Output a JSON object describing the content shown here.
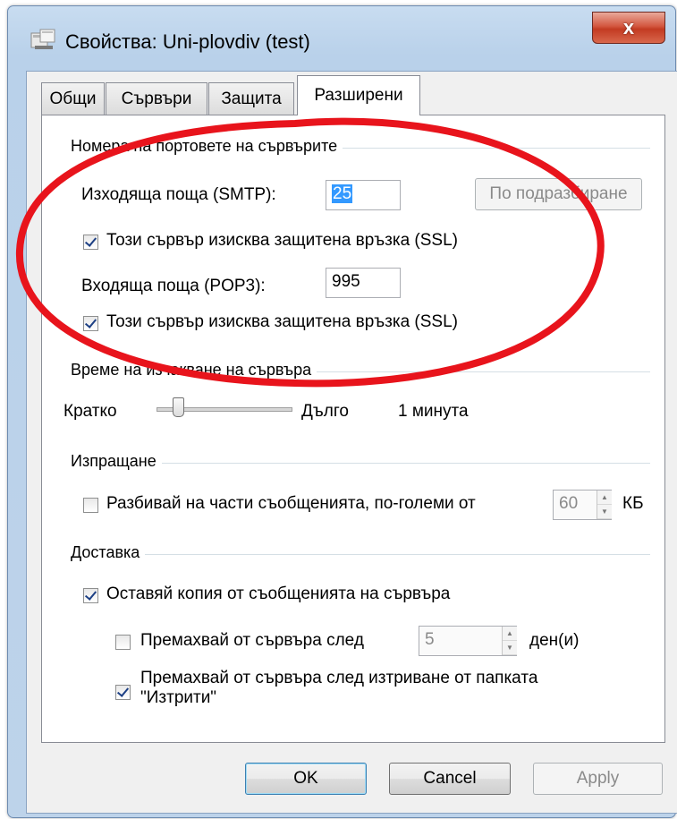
{
  "window": {
    "title": "Свойства: Uni-plovdiv (test)",
    "close_label": "x"
  },
  "tabs": [
    {
      "label": "Общи"
    },
    {
      "label": "Сървъри"
    },
    {
      "label": "Защита"
    },
    {
      "label": "Разширени",
      "active": true
    }
  ],
  "ports": {
    "group_title": "Номера на портовете на сървърите",
    "smtp_label": "Изходяща поща (SMTP):",
    "smtp_value": "25",
    "default_button": "По подразбиране",
    "smtp_ssl_label": "Този сървър изисква защитена връзка (SSL)",
    "smtp_ssl_checked": true,
    "pop3_label": "Входяща поща (POP3):",
    "pop3_value": "995",
    "pop3_ssl_label": "Този сървър изисква защитена връзка (SSL)",
    "pop3_ssl_checked": true
  },
  "timeout": {
    "group_title": "Време на изчакване на сървъра",
    "short_label": "Кратко",
    "long_label": "Дълго",
    "value_text": "1 минута"
  },
  "sending": {
    "group_title": "Изпращане",
    "split_label": "Разбивай на части съобщенията, по-големи от",
    "split_checked": false,
    "split_value": "60",
    "split_unit": "КБ"
  },
  "delivery": {
    "group_title": "Доставка",
    "leave_copy_label": "Оставяй копия от съобщенията на сървъра",
    "leave_copy_checked": true,
    "remove_after_label": "Премахвай от сървъра след",
    "remove_after_checked": false,
    "remove_after_value": "5",
    "remove_after_unit": "ден(и)",
    "remove_deleted_label_line1": "Премахвай от сървъра след изтриване от папката",
    "remove_deleted_label_line2": "\"Изтрити\"",
    "remove_deleted_checked": true
  },
  "buttons": {
    "ok": "OK",
    "cancel": "Cancel",
    "apply": "Apply"
  },
  "colors": {
    "annotation_oval": "#e8141c",
    "title_bar": "#b9d1ea",
    "close_button": "#c8432b"
  }
}
